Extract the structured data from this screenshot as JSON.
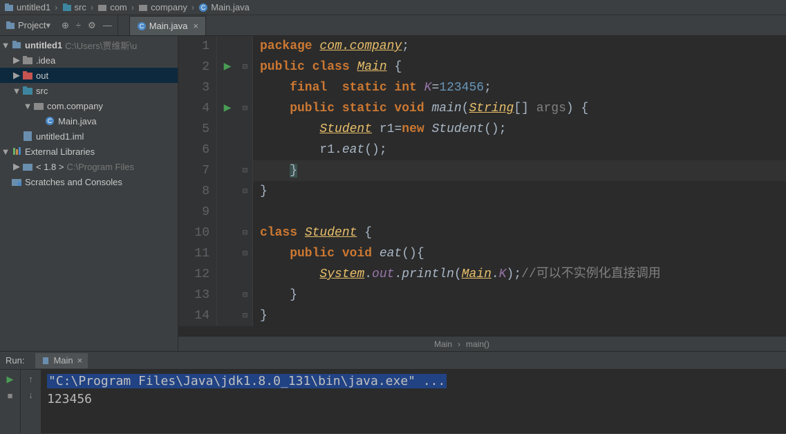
{
  "breadcrumb": [
    "untitled1",
    "src",
    "com",
    "company",
    "Main.java"
  ],
  "project_label": "Project",
  "tab": {
    "name": "Main.java"
  },
  "tree": {
    "root": {
      "name": "untitled1",
      "path": " C:\\Users\\贾维斯\\u"
    },
    "idea": ".idea",
    "out": "out",
    "src": "src",
    "pkg": "com.company",
    "file": "Main.java",
    "iml": "untitled1.iml",
    "ext": "External Libraries",
    "jdk": "< 1.8 >",
    "jdk_path": " C:\\Program Files",
    "scratches": "Scratches and Consoles"
  },
  "code": {
    "l1": {
      "n": "1",
      "pkg": "package ",
      "pkgname": "com.company",
      "semi": ";"
    },
    "l2": {
      "n": "2",
      "a": "public class ",
      "main": "Main",
      "b": " {"
    },
    "l3": {
      "n": "3",
      "a": "    final  static int ",
      "k": "K",
      "eq": "=",
      "num": "123456",
      "semi": ";"
    },
    "l4": {
      "n": "4",
      "a": "    public static void ",
      "main": "main",
      "op": "(",
      "str": "String",
      "arr": "[] ",
      "args": "args",
      "cp": ")",
      "b": " {"
    },
    "l5": {
      "n": "5",
      "a": "        ",
      "stu": "Student",
      "sp": " r1=",
      "nw": "new ",
      "stu2": "Student",
      "rest": "();"
    },
    "l6": {
      "n": "6",
      "a": "        r1.",
      "eat": "eat",
      "rest": "();"
    },
    "l7": {
      "n": "7",
      "a": "    ",
      "b": "}"
    },
    "l8": {
      "n": "8",
      "b": "}"
    },
    "l9": {
      "n": "9"
    },
    "l10": {
      "n": "10",
      "a": "class ",
      "stu": "Student",
      "b": " {"
    },
    "l11": {
      "n": "11",
      "a": "    public void ",
      "eat": "eat",
      "rest": "(){"
    },
    "l12": {
      "n": "12",
      "a": "        ",
      "sys": "System",
      "dot": ".",
      "out": "out",
      "dot2": ".",
      "pln": "println",
      "op": "(",
      "main": "Main",
      "dot3": ".",
      "k": "K",
      "cp": ");",
      "cmt": "//可以不实例化直接调用"
    },
    "l13": {
      "n": "13",
      "a": "    ",
      "b": "}"
    },
    "l14": {
      "n": "14",
      "b": "}"
    }
  },
  "editor_crumbs": {
    "a": "Main",
    "b": "main()"
  },
  "run": {
    "title": "Run:",
    "tab": "Main",
    "cmd": "\"C:\\Program Files\\Java\\jdk1.8.0_131\\bin\\java.exe\" ...",
    "output": "123456"
  }
}
